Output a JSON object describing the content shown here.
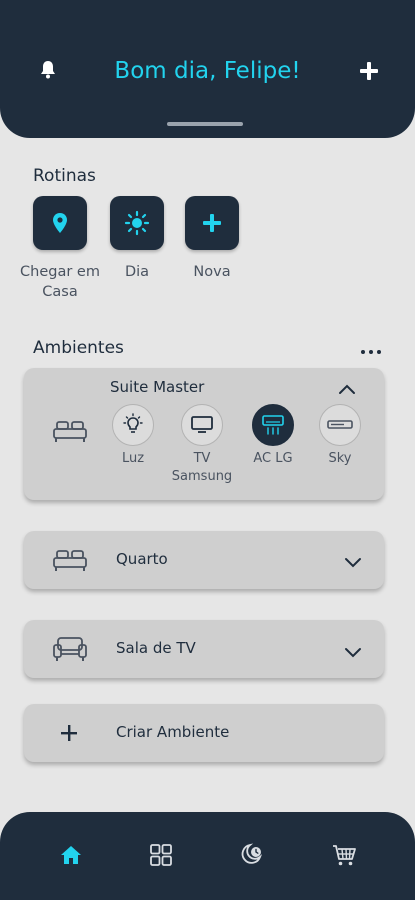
{
  "header": {
    "greeting": "Bom dia, Felipe!"
  },
  "rotinas": {
    "title": "Rotinas",
    "items": [
      {
        "label": "Chegar em Casa",
        "icon": "location-pin-icon"
      },
      {
        "label": "Dia",
        "icon": "sun-icon"
      },
      {
        "label": "Nova",
        "icon": "plus-icon"
      }
    ]
  },
  "ambientes": {
    "title": "Ambientes",
    "expanded_room": {
      "name": "Suite Master",
      "devices": [
        {
          "label": "Luz",
          "icon": "lightbulb-icon",
          "active": false
        },
        {
          "label": "TV Samsung",
          "icon": "tv-icon",
          "active": false
        },
        {
          "label": "AC LG",
          "icon": "air-conditioner-icon",
          "active": true
        },
        {
          "label": "Sky",
          "icon": "set-top-box-icon",
          "active": false
        }
      ]
    },
    "rooms": [
      {
        "name": "Quarto",
        "icon": "bed-icon"
      },
      {
        "name": "Sala de TV",
        "icon": "sofa-icon"
      }
    ],
    "create_label": "Criar Ambiente"
  },
  "colors": {
    "primary": "#1f2d3d",
    "accent": "#22d3ee",
    "background": "#e6e6e6",
    "card": "#cfcfcf"
  },
  "bottom_nav": {
    "items": [
      "home-icon",
      "grid-icon",
      "routines-icon",
      "cart-icon"
    ],
    "active": "home-icon"
  }
}
